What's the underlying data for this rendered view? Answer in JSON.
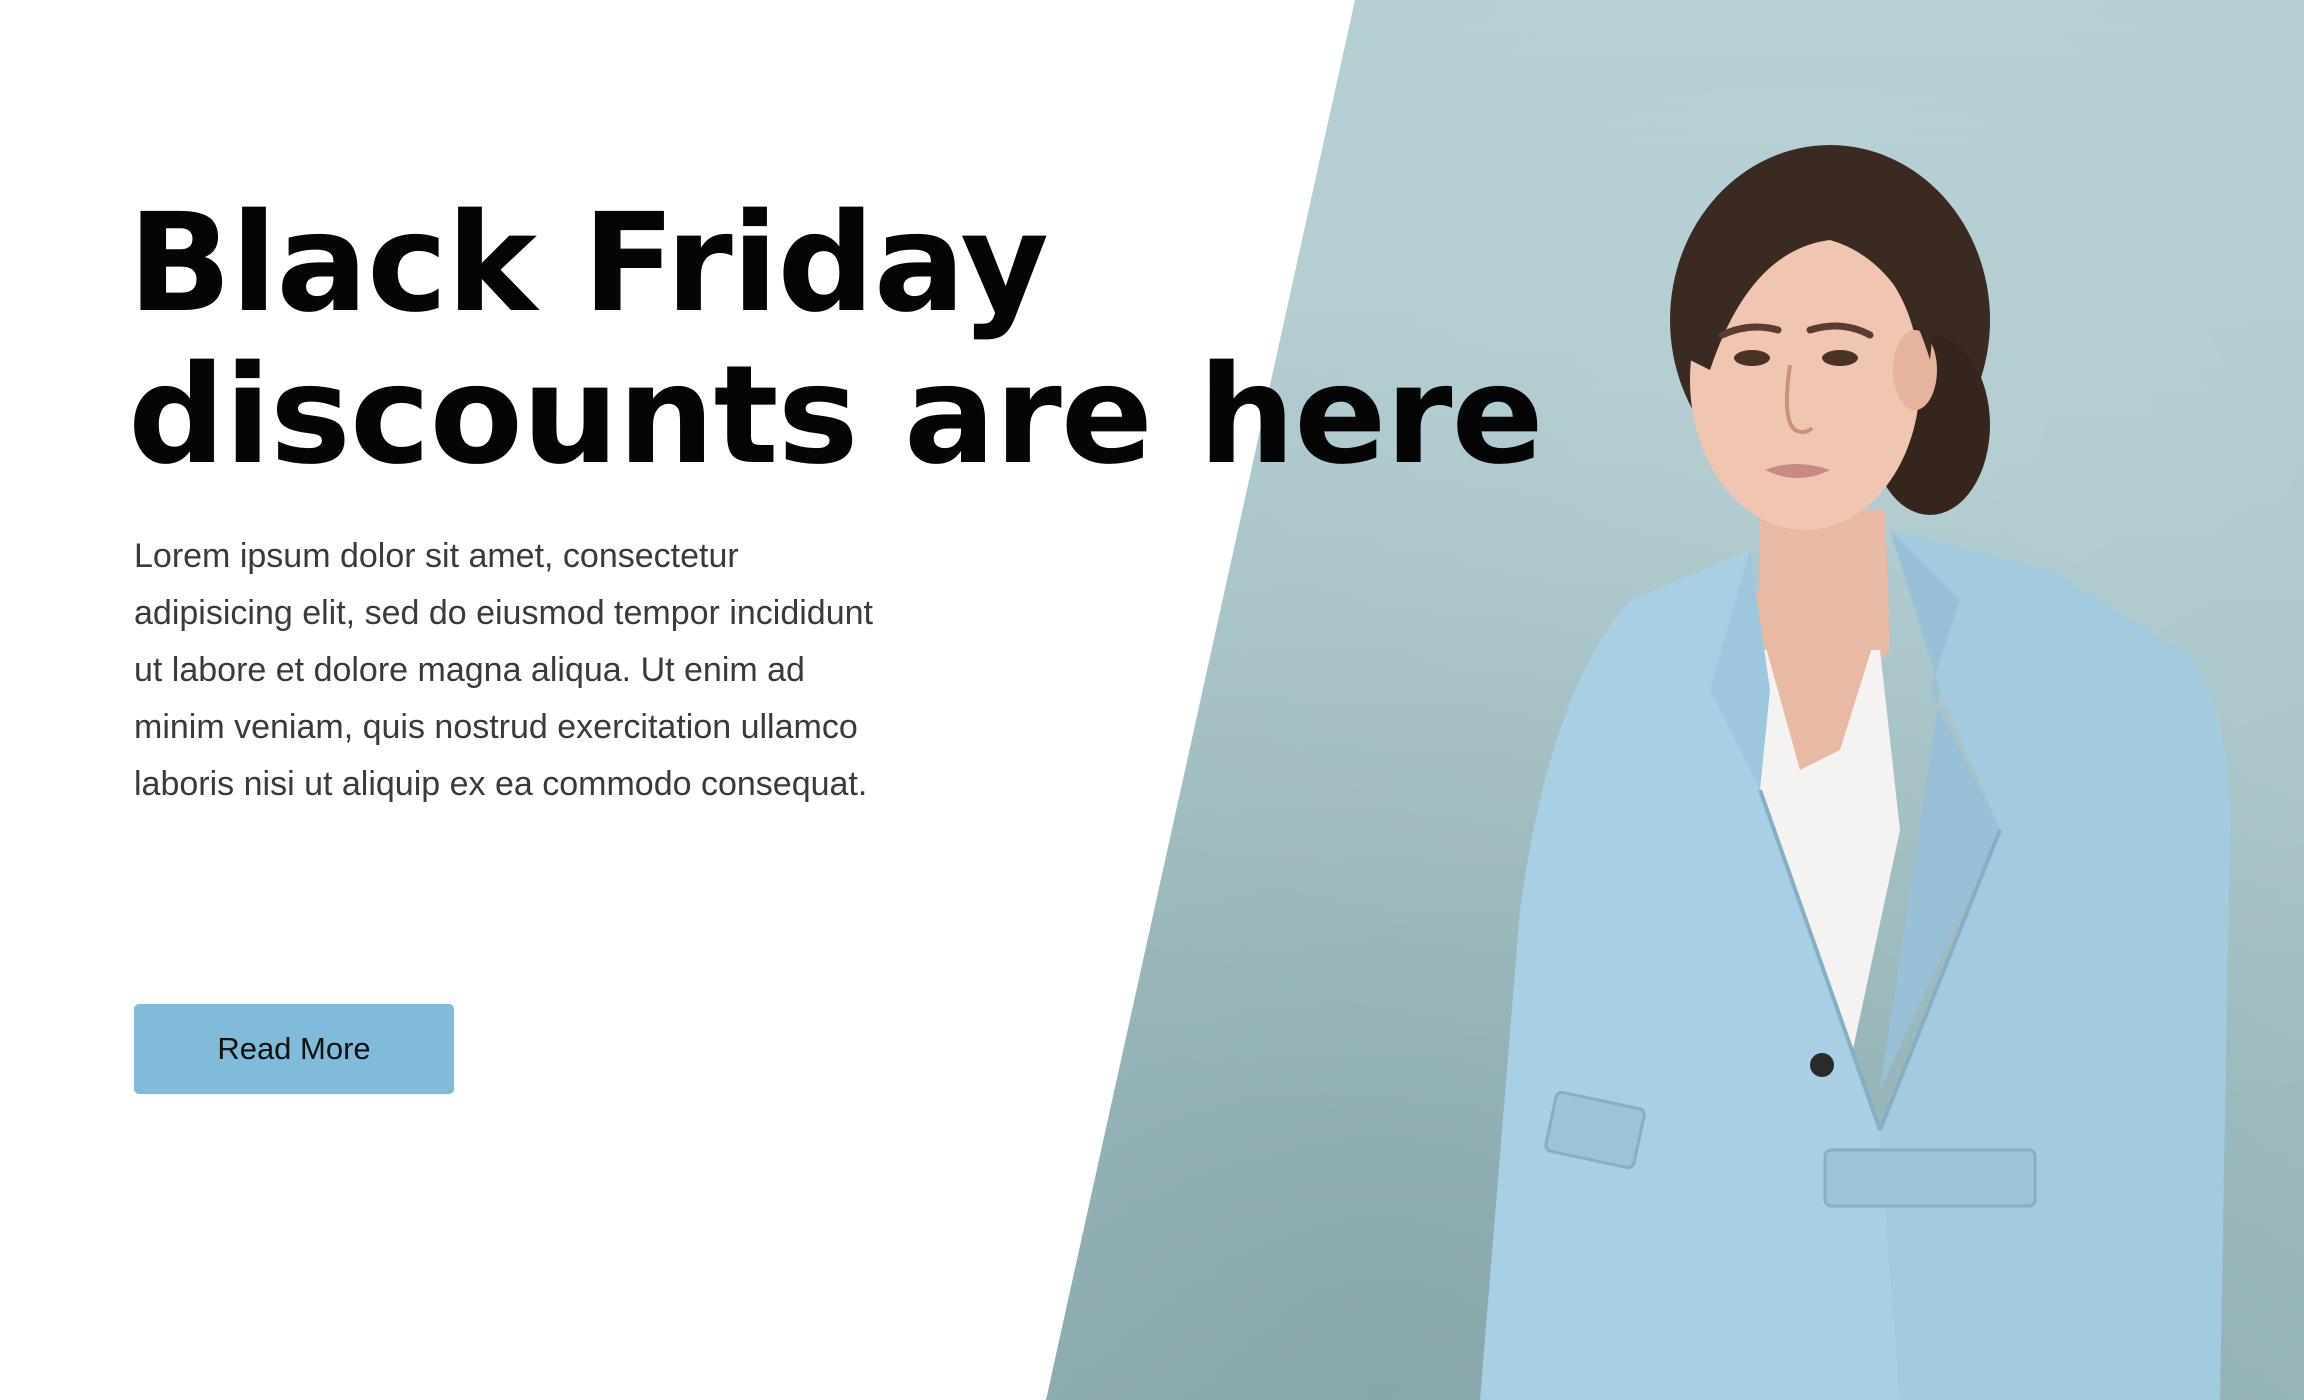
{
  "hero": {
    "headline_line1": "Black Friday",
    "headline_line2": "discounts are here",
    "body": "Lorem ipsum dolor sit amet, consectetur adipisicing elit, sed do eiusmod tempor incididunt ut labore et dolore magna aliqua. Ut enim ad minim veniam, quis nostrud exercitation ullamco laboris nisi ut aliquip ex ea commodo consequat.",
    "cta_label": "Read More"
  },
  "colors": {
    "background": "#ffffff",
    "photo_backdrop": "#aac7cc",
    "button": "#80bbd9",
    "headline": "#050505",
    "body_text": "#3a3a3a",
    "blazer": "#a8cfe3"
  }
}
